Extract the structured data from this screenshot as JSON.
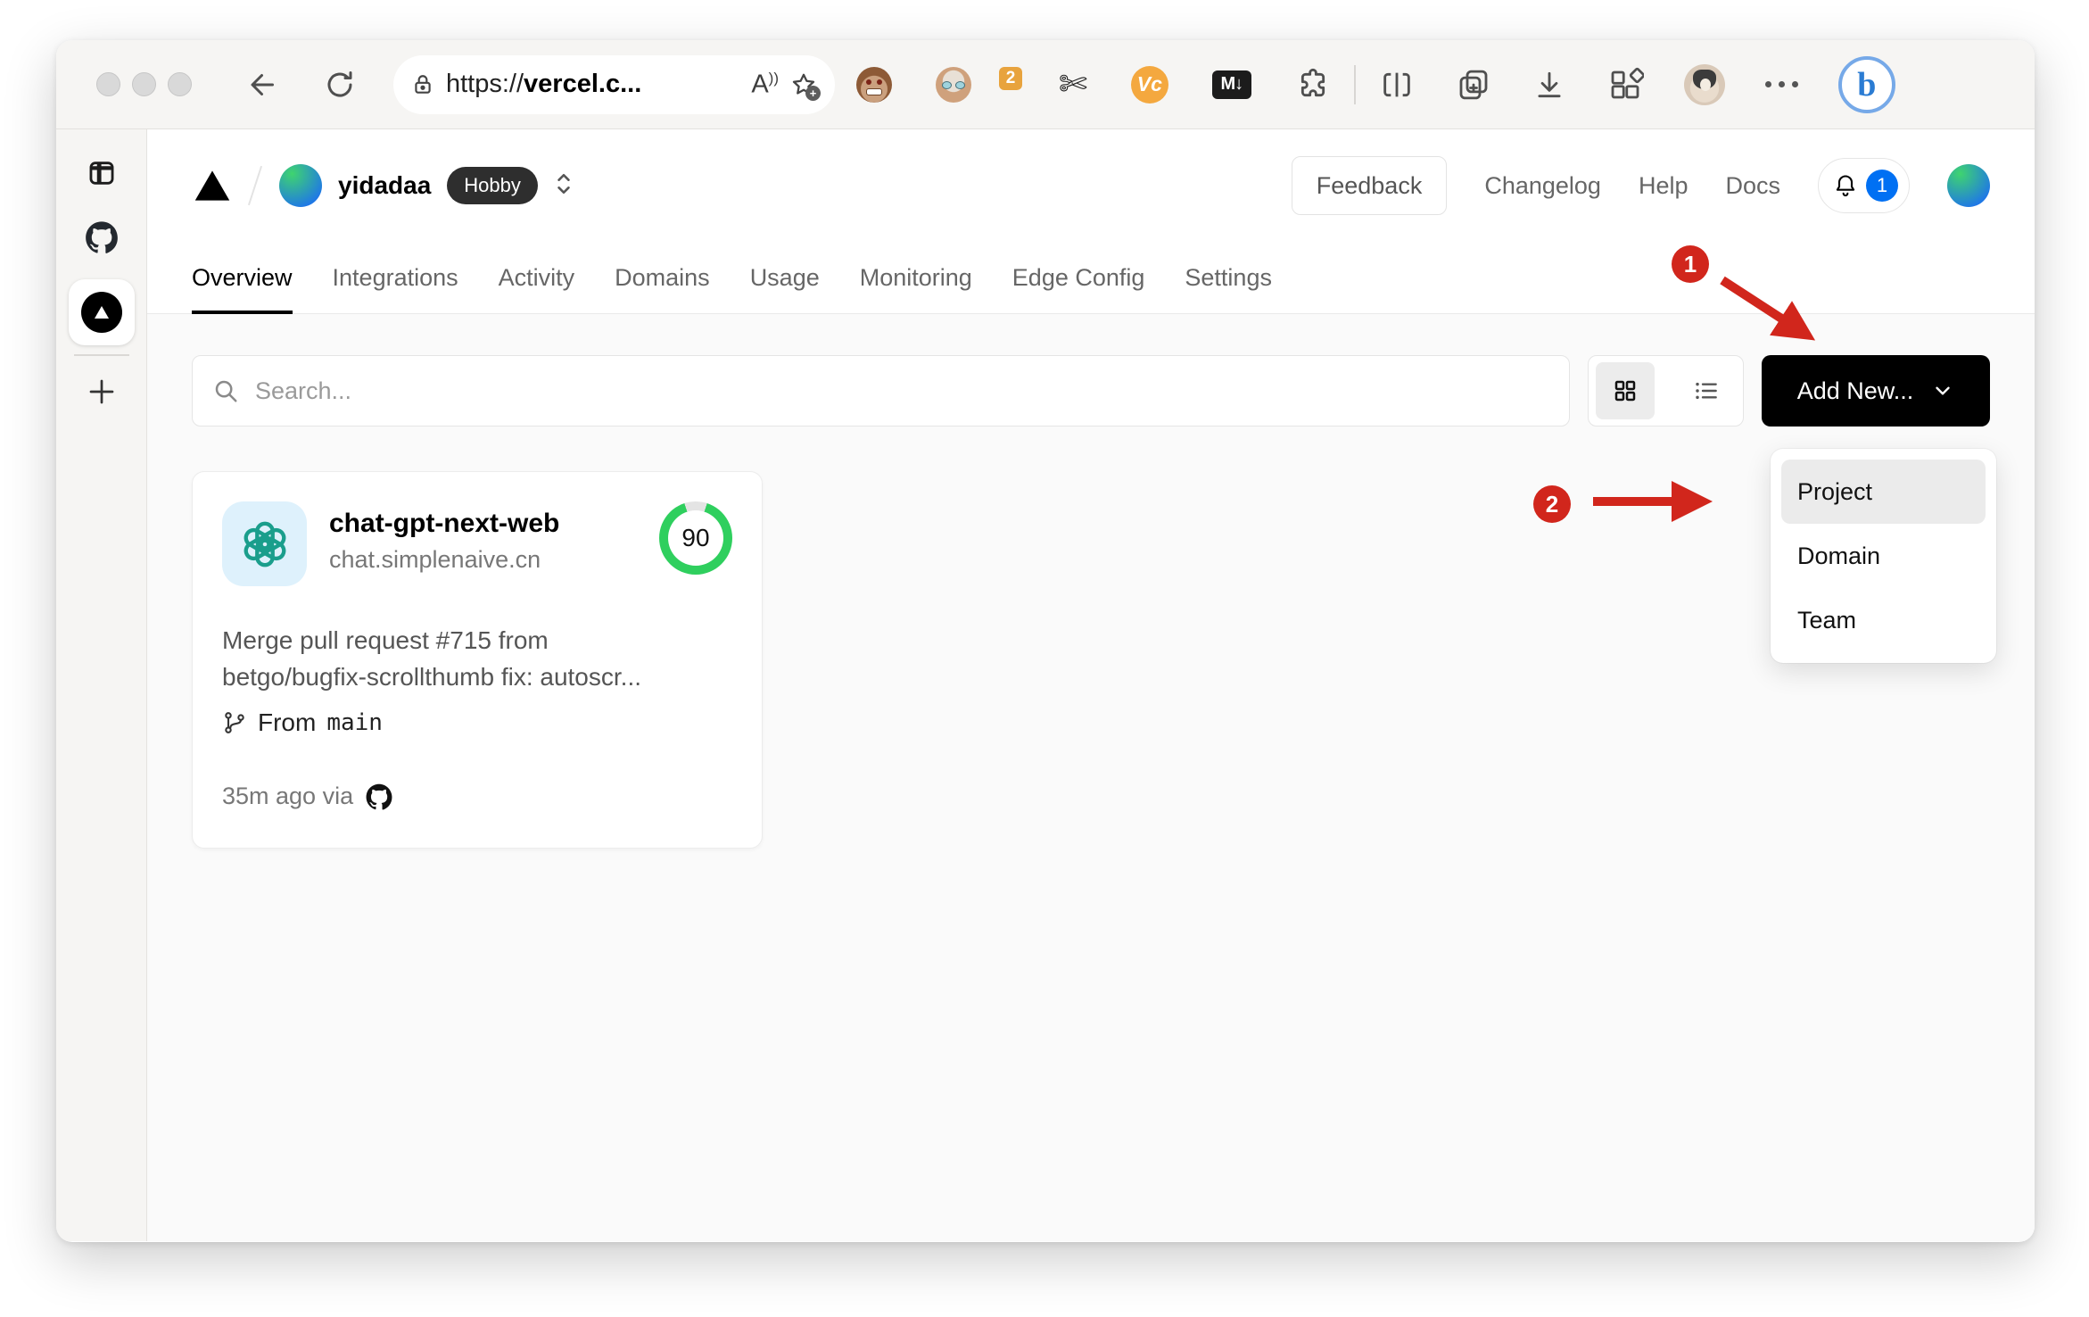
{
  "browser": {
    "url": {
      "prefix": "https://",
      "domain": "vercel.c..."
    },
    "reader_label": "A",
    "extension_badge_count": "2",
    "vc_extension_label": "Vc",
    "markdown_extension_label": "M↓",
    "bing_label": "b"
  },
  "header": {
    "team_name": "yidadaa",
    "plan_badge": "Hobby",
    "feedback_label": "Feedback",
    "changelog_label": "Changelog",
    "help_label": "Help",
    "docs_label": "Docs",
    "notification_count": "1"
  },
  "nav": {
    "tabs": [
      {
        "label": "Overview",
        "active": true
      },
      {
        "label": "Integrations",
        "active": false
      },
      {
        "label": "Activity",
        "active": false
      },
      {
        "label": "Domains",
        "active": false
      },
      {
        "label": "Usage",
        "active": false
      },
      {
        "label": "Monitoring",
        "active": false
      },
      {
        "label": "Edge Config",
        "active": false
      },
      {
        "label": "Settings",
        "active": false
      }
    ]
  },
  "toolbar": {
    "search_placeholder": "Search...",
    "add_new_label": "Add New..."
  },
  "project_card": {
    "name": "chat-gpt-next-web",
    "domain": "chat.simplenaive.cn",
    "score": "90",
    "commit_lines": [
      "Merge pull request #715 from",
      "betgo/bugfix-scrollthumb fix: autoscr..."
    ],
    "branch_label": "From",
    "branch_name": "main",
    "deployed_text": "35m ago via"
  },
  "dropdown": {
    "items": [
      {
        "label": "Project",
        "highlighted": true
      },
      {
        "label": "Domain",
        "highlighted": false
      },
      {
        "label": "Team",
        "highlighted": false
      }
    ]
  },
  "annotations": {
    "step1": "1",
    "step2": "2"
  },
  "colors": {
    "accent_blue": "#0070f3",
    "success_green": "#2fcf5e",
    "annotation_red": "#d1261c",
    "plan_badge_dark": "#2e2e2e"
  }
}
